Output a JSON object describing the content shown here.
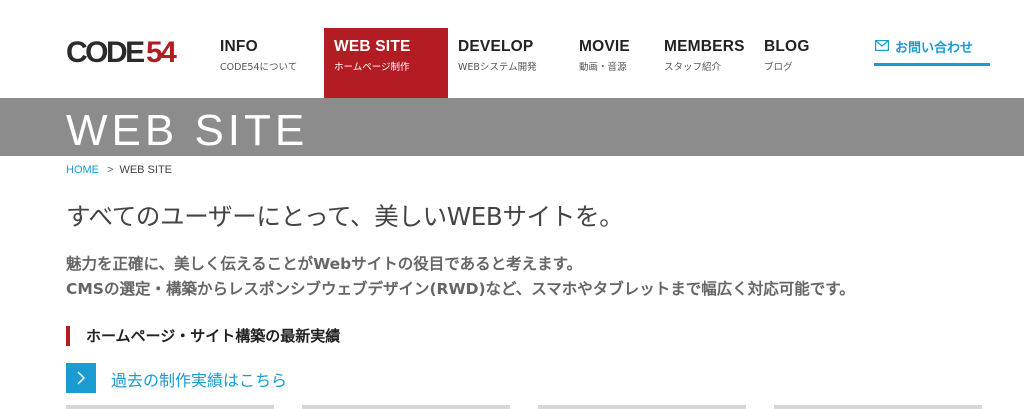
{
  "brand": {
    "logo_text": "CODE54",
    "colors": {
      "dark": "#2b2b2b",
      "red": "#b21c22"
    }
  },
  "nav": [
    {
      "en": "INFO",
      "ja": "CODE54について",
      "active": false
    },
    {
      "en": "WEB SITE",
      "ja": "ホームページ制作",
      "active": true
    },
    {
      "en": "DEVELOP",
      "ja": "WEBシステム開発",
      "active": false
    },
    {
      "en": "MOVIE",
      "ja": "動画・音源",
      "active": false
    },
    {
      "en": "MEMBERS",
      "ja": "スタッフ紹介",
      "active": false
    },
    {
      "en": "BLOG",
      "ja": "ブログ",
      "active": false
    }
  ],
  "contact": {
    "label": "お問い合わせ",
    "icon": "mail-icon",
    "color": "#1a9bd1"
  },
  "banner": {
    "title": "WEB SITE",
    "bg": "#8c8c8c"
  },
  "breadcrumb": {
    "home": "HOME",
    "separator": ">",
    "current": "WEB SITE"
  },
  "headline": "すべてのユーザーにとって、美しいWEBサイトを。",
  "description": [
    "魅力を正確に、美しく伝えることがWebサイトの役目であると考えます。",
    "CMSの選定・構築からレスポンシブウェブデザイン(RWD)など、スマホやタブレットまで幅広く対応可能です。"
  ],
  "section": {
    "title": "ホームページ・サイト構築の最新実績",
    "accent": "#b21c22"
  },
  "more_link": {
    "label": "過去の制作実績はこちら",
    "icon": "chevron-right-icon",
    "color": "#1a9bd1"
  }
}
